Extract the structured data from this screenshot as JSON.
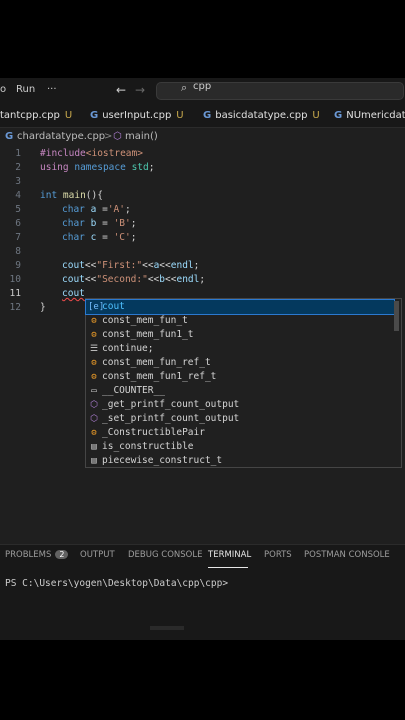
{
  "titlebar": {
    "menu_tail": "o",
    "run": "Run",
    "more": "···",
    "back": "←",
    "forward": "→",
    "search_text": "cpp"
  },
  "tabs": [
    {
      "label": "tantcpp.cpp",
      "mark": "U"
    },
    {
      "label": "userInput.cpp",
      "mark": "U"
    },
    {
      "label": "basicdatatype.cpp",
      "mark": "U"
    },
    {
      "label": "NUmericdata.",
      "mark": ""
    }
  ],
  "breadcrumb": {
    "file": "chardatatype.cpp",
    "sep": ">",
    "symbol": "main()"
  },
  "editor": {
    "current_line": 11,
    "line_numbers": [
      "1",
      "2",
      "3",
      "4",
      "5",
      "6",
      "7",
      "8",
      "9",
      "10",
      "11",
      "12"
    ]
  },
  "suggestions": [
    {
      "label": "cout",
      "icon": "variable-icon",
      "icon_glyph": "[e]",
      "color": "#75beff"
    },
    {
      "label": "const_mem_fun_t",
      "icon": "class-icon",
      "icon_glyph": "⚙",
      "color": "#ee9d28"
    },
    {
      "label": "const_mem_fun1_t",
      "icon": "class-icon",
      "icon_glyph": "⚙",
      "color": "#ee9d28"
    },
    {
      "label": "continue;",
      "icon": "snippet-icon",
      "icon_glyph": "☰",
      "color": "#cccccc"
    },
    {
      "label": "const_mem_fun_ref_t",
      "icon": "class-icon",
      "icon_glyph": "⚙",
      "color": "#ee9d28"
    },
    {
      "label": "const_mem_fun1_ref_t",
      "icon": "class-icon",
      "icon_glyph": "⚙",
      "color": "#ee9d28"
    },
    {
      "label": "__COUNTER__",
      "icon": "constant-icon",
      "icon_glyph": "▭",
      "color": "#cccccc"
    },
    {
      "label": "_get_printf_count_output",
      "icon": "method-icon",
      "icon_glyph": "⬡",
      "color": "#b180d7"
    },
    {
      "label": "_set_printf_count_output",
      "icon": "method-icon",
      "icon_glyph": "⬡",
      "color": "#b180d7"
    },
    {
      "label": "_ConstructiblePair",
      "icon": "class-icon",
      "icon_glyph": "⚙",
      "color": "#ee9d28"
    },
    {
      "label": "is_constructible",
      "icon": "struct-icon",
      "icon_glyph": "▤",
      "color": "#cccccc"
    },
    {
      "label": "piecewise_construct_t",
      "icon": "struct-icon",
      "icon_glyph": "▤",
      "color": "#cccccc"
    }
  ],
  "panel": {
    "tabs": [
      {
        "label": "PROBLEMS",
        "badge": "2"
      },
      {
        "label": "OUTPUT"
      },
      {
        "label": "DEBUG CONSOLE"
      },
      {
        "label": "TERMINAL"
      },
      {
        "label": "PORTS"
      },
      {
        "label": "POSTMAN CONSOLE"
      }
    ],
    "active_tab": "TERMINAL",
    "terminal_prompt": "PS C:\\Users\\yogen\\Desktop\\Data\\cpp\\cpp>"
  },
  "colors": {
    "editor_bg": "#1f1f1f",
    "selection": "#04395e",
    "accent": "#2aaaff"
  }
}
